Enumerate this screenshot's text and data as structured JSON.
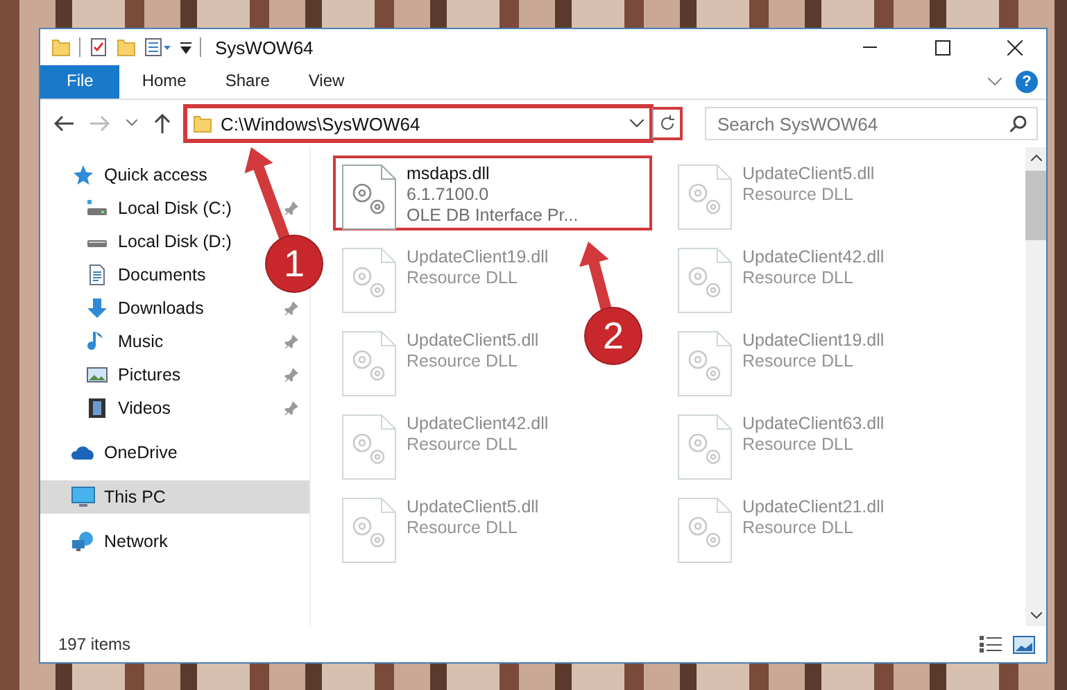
{
  "window": {
    "title": "SysWOW64"
  },
  "ribbon": {
    "tabs": [
      {
        "label": "File",
        "kind": "file"
      },
      {
        "label": "Home",
        "kind": "tab"
      },
      {
        "label": "Share",
        "kind": "tab"
      },
      {
        "label": "View",
        "kind": "tab"
      }
    ],
    "help_button": {
      "label": "?"
    }
  },
  "address_bar": {
    "value": "C:\\Windows\\SysWOW64",
    "highlighted": true
  },
  "search": {
    "placeholder": "Search SysWOW64"
  },
  "sidebar": {
    "items": [
      {
        "label": "Quick access",
        "kind": "star",
        "selected": false,
        "children": [
          {
            "label": "Local Disk (C:)",
            "kind": "drive-c",
            "pinned": true,
            "selected": false
          },
          {
            "label": "Local Disk (D:)",
            "kind": "drive",
            "pinned": false,
            "selected": false
          },
          {
            "label": "Documents",
            "kind": "documents",
            "pinned": false,
            "selected": false
          },
          {
            "label": "Downloads",
            "kind": "downloads",
            "pinned": true,
            "selected": false
          },
          {
            "label": "Music",
            "kind": "music",
            "pinned": true,
            "selected": false
          },
          {
            "label": "Pictures",
            "kind": "pictures",
            "pinned": true,
            "selected": false
          },
          {
            "label": "Videos",
            "kind": "videos",
            "pinned": true,
            "selected": false
          }
        ]
      },
      {
        "label": "OneDrive",
        "kind": "cloud",
        "selected": false
      },
      {
        "label": "This PC",
        "kind": "pc",
        "selected": true
      },
      {
        "label": "Network",
        "kind": "network",
        "selected": false
      }
    ]
  },
  "files": [
    {
      "name": "msdaps.dll",
      "version": "6.1.7100.0",
      "description": "OLE DB Interface Pr...",
      "dimmed": false,
      "highlighted": true
    },
    {
      "name": "UpdateClient5.dll",
      "description": "Resource DLL",
      "dimmed": true,
      "highlighted": false
    },
    {
      "name": "UpdateClient19.dll",
      "description": "Resource DLL",
      "dimmed": true,
      "highlighted": false
    },
    {
      "name": "UpdateClient42.dll",
      "description": "Resource DLL",
      "dimmed": true,
      "highlighted": false
    },
    {
      "name": "UpdateClient5.dll",
      "description": "Resource DLL",
      "dimmed": true,
      "highlighted": false
    },
    {
      "name": "UpdateClient19.dll",
      "description": "Resource DLL",
      "dimmed": true,
      "highlighted": false
    },
    {
      "name": "UpdateClient42.dll",
      "description": "Resource DLL",
      "dimmed": true,
      "highlighted": false
    },
    {
      "name": "UpdateClient63.dll",
      "description": "Resource DLL",
      "dimmed": true,
      "highlighted": false
    },
    {
      "name": "UpdateClient5.dll",
      "description": "Resource DLL",
      "dimmed": true,
      "highlighted": false
    },
    {
      "name": "UpdateClient21.dll",
      "description": "Resource DLL",
      "dimmed": true,
      "highlighted": false
    }
  ],
  "status_bar": {
    "item_count": "197 items"
  },
  "callouts": [
    {
      "number": "1"
    },
    {
      "number": "2"
    }
  ]
}
